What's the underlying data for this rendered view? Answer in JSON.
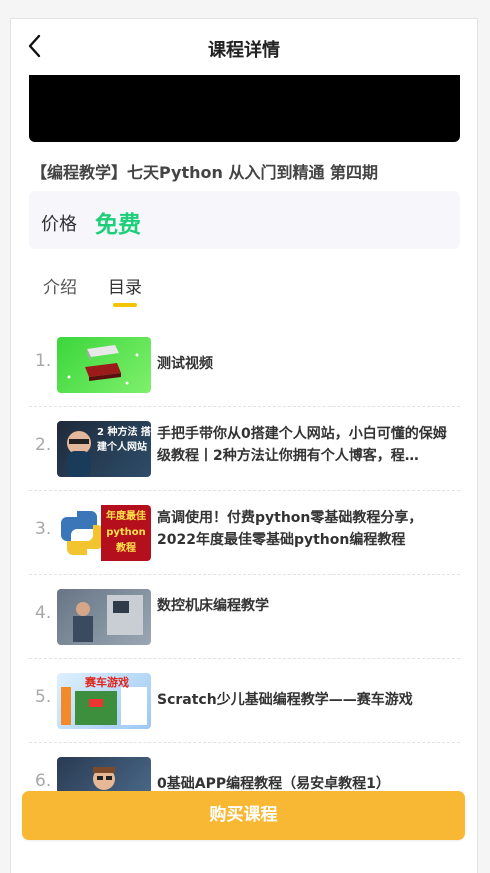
{
  "navbar": {
    "title": "课程详情"
  },
  "course": {
    "title": "【编程教学】七天Python 从入门到精通 第四期"
  },
  "price": {
    "label": "价格",
    "value": "免费"
  },
  "tabs": [
    {
      "label": "介绍"
    },
    {
      "label": "目录"
    }
  ],
  "active_tab": "目录",
  "lessons": [
    {
      "number": "1.",
      "title": "测试视频",
      "thumb": "green-clip",
      "thumb_text": ""
    },
    {
      "number": "2.",
      "title": "手把手带你从0搭建个人网站，小白可懂的保姆级教程丨2种方法让你拥有个人博客，程…",
      "thumb": "person-website",
      "thumb_text": "2 种方法 搭建个人网站"
    },
    {
      "number": "3.",
      "title": "高调使用！付费python零基础教程分享，2022年度最佳零基础python编程教程",
      "thumb": "python-logo",
      "thumb_text": "年度最佳 python 教程"
    },
    {
      "number": "4.",
      "title": "数控机床编程教学",
      "thumb": "machine-tool",
      "thumb_text": ""
    },
    {
      "number": "5.",
      "title": "Scratch少儿基础编程教学——赛车游戏",
      "thumb": "scratch-race",
      "thumb_text": "赛车游戏"
    },
    {
      "number": "6.",
      "title": "0基础APP编程教程（易安卓教程1）",
      "thumb": "kid-code",
      "thumb_text": ""
    }
  ],
  "buy_button": {
    "label": "购买课程"
  },
  "colors": {
    "accent": "#f8b833",
    "price": "#1ecf7a",
    "tab_underline": "#f5c400"
  }
}
